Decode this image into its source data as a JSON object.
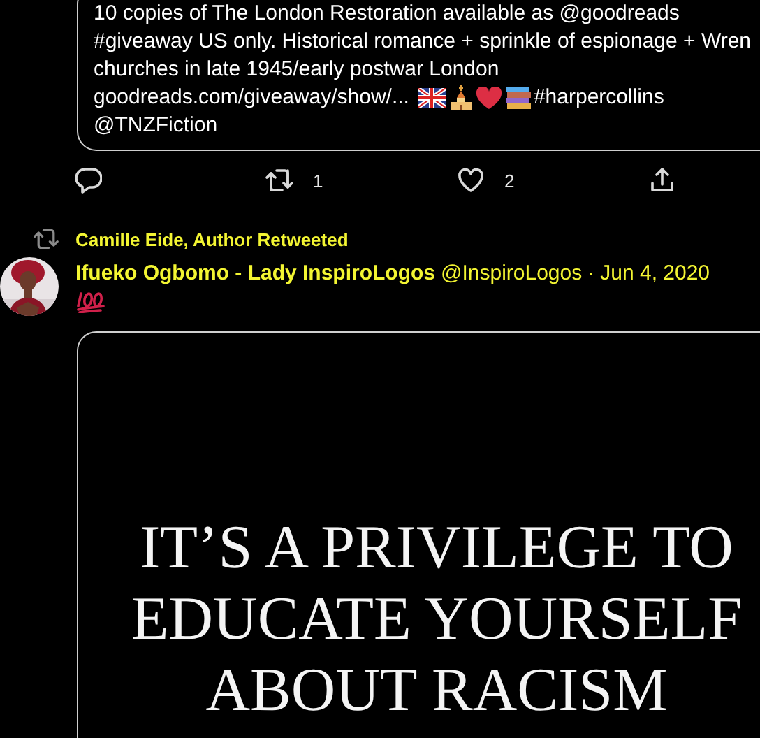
{
  "previous_tweet": {
    "text": "10 copies of The London Restoration available as @goodreads\n#giveaway US only. Historical romance + sprinkle of espionage + Wren\nchurches in late 1945/early postwar London",
    "link": "goodreads.com/giveaway/show/...",
    "hashtag": "#harpercollins",
    "mention": "@TNZFiction",
    "actions": [
      {
        "kind": "reply"
      },
      {
        "kind": "retweet",
        "count": "1"
      },
      {
        "kind": "like",
        "count": "2"
      },
      {
        "kind": "share"
      }
    ]
  },
  "tweet": {
    "retweeted_by": "Camille Eide, Author Retweeted",
    "author": "Ifueko Ogbomo - Lady InspiroLogos",
    "handle": "@InspiroLogos",
    "separator": "·",
    "date": "Jun 4, 2020",
    "media": {
      "text_lines": [
        "IT’S A PRIVILEGE TO",
        "EDUCATE YOURSELF",
        "ABOUT RACISM"
      ]
    }
  }
}
